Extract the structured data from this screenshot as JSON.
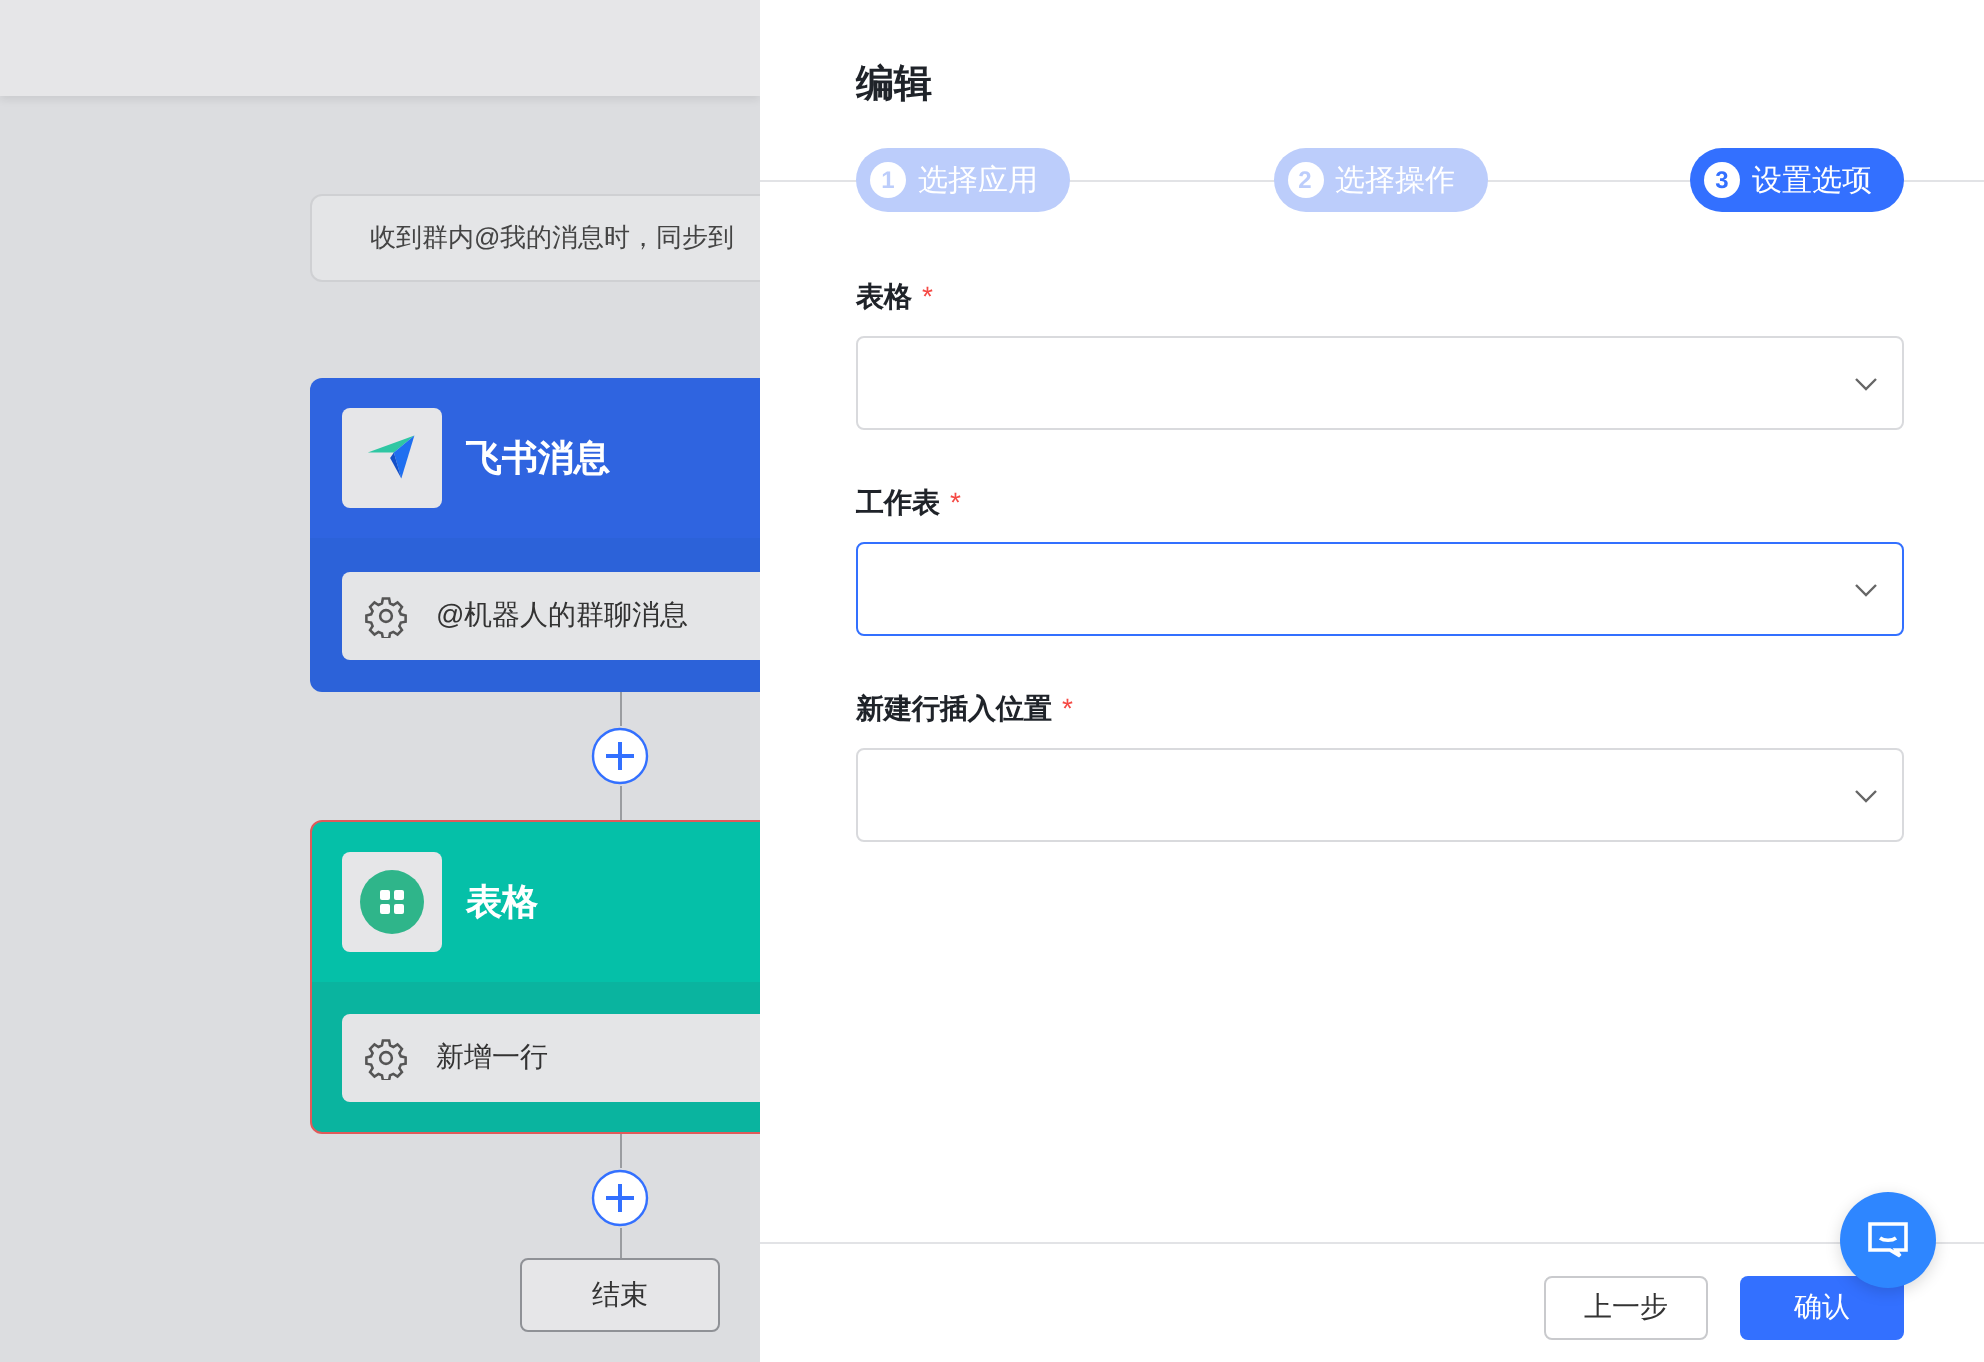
{
  "canvas": {
    "note": "收到群内@我的消息时，同步到",
    "nodes": [
      {
        "kind": "message",
        "title": "飞书消息",
        "action": "@机器人的群聊消息",
        "highlighted": false
      },
      {
        "kind": "sheet",
        "title": "表格",
        "action": "新增一行",
        "highlighted": true
      }
    ],
    "end_label": "结束"
  },
  "drawer": {
    "title": "编辑",
    "steps": [
      {
        "number": "1",
        "label": "选择应用",
        "selected": false
      },
      {
        "number": "2",
        "label": "选择操作",
        "selected": false
      },
      {
        "number": "3",
        "label": "设置选项",
        "selected": true
      }
    ],
    "fields": [
      {
        "label": "表格",
        "required_mark": "*",
        "focused": false
      },
      {
        "label": "工作表",
        "required_mark": "*",
        "focused": true
      },
      {
        "label": "新建行插入位置",
        "required_mark": "*",
        "focused": false
      }
    ],
    "buttons": [
      {
        "label": "上一步",
        "kind": "secondary"
      },
      {
        "label": "确认",
        "kind": "primary"
      }
    ]
  }
}
